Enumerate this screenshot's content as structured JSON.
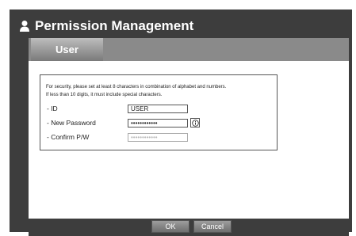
{
  "window": {
    "title": "Permission Management",
    "icon": "user-icon"
  },
  "tabs": [
    {
      "label": "User",
      "active": true
    }
  ],
  "notice": {
    "line1": "For security, please set at least 8 characters in combination of alphabet and numbers.",
    "line2": "If less than 10 digits, it must include special characters."
  },
  "form": {
    "id": {
      "label": "- ID",
      "value": "USER"
    },
    "new_password": {
      "label": "- New Password",
      "value": "••••••••••••",
      "info_icon": "info-icon"
    },
    "confirm_password": {
      "label": "- Confirm P/W",
      "value": "••••••••••••"
    }
  },
  "buttons": {
    "ok": "OK",
    "cancel": "Cancel"
  },
  "colors": {
    "window_bg": "#3d3d3d",
    "tab_bar": "#8a8a8a",
    "panel": "#ffffff",
    "button": "#7f7f7f"
  }
}
